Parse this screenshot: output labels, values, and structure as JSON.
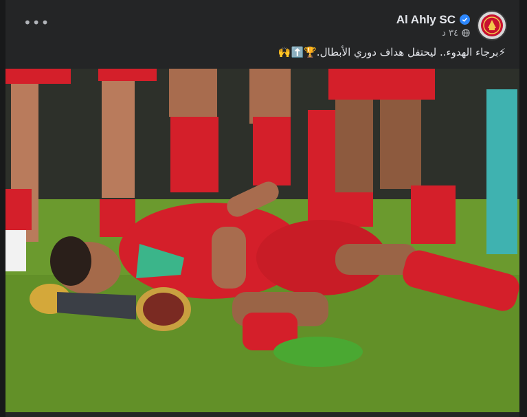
{
  "post": {
    "page_name": "Al Ahly SC",
    "timestamp": "٣٤ د",
    "caption": "⚡برجاء الهدوء.. ليحتفل هداف دوري الأبطال.🏆⬆️🙌"
  },
  "icons": {
    "more": "more-options-icon",
    "verified": "verified-badge-icon",
    "globe": "globe-icon"
  },
  "colors": {
    "background": "#242526",
    "text": "#e4e6eb",
    "secondary": "#b0b3b8",
    "verified": "#2d88ff",
    "club_red": "#c8102e"
  }
}
